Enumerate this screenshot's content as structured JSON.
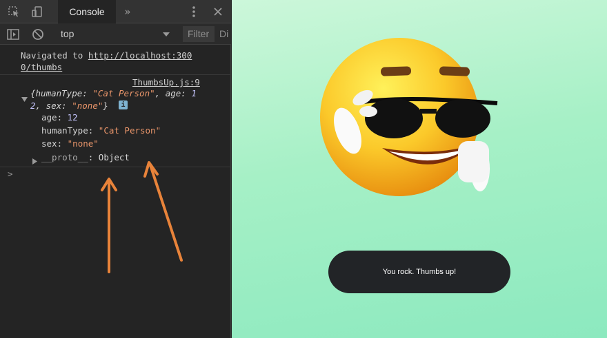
{
  "devtools": {
    "tabs": {
      "console_label": "Console"
    },
    "toolbar": {
      "context": "top",
      "filter_placeholder": "Filter",
      "overflow_text": "Di"
    },
    "console": {
      "nav_prefix": "Navigated to ",
      "nav_url_line1": "http://localhost:300",
      "nav_url_line2": "0/thumbs",
      "source_link": "ThumbsUp.js:9",
      "obj_summary": {
        "open": "{",
        "k1": "humanType",
        "v1": "\"Cat Person\"",
        "k2": "age",
        "v2_line1": "1",
        "v2_line2": "2",
        "k3": "sex",
        "v3": "\"none\"",
        "close": "}"
      },
      "props": [
        {
          "name": "age",
          "value": "12"
        },
        {
          "name": "humanType",
          "value": "\"Cat Person\""
        },
        {
          "name": "sex",
          "value": "\"none\""
        }
      ],
      "proto": {
        "name": "__proto__",
        "value": "Object"
      },
      "prompt": ">"
    },
    "icons": [
      "inspect-icon",
      "device-toggle-icon",
      "more-tabs-icon",
      "kebab-menu-icon",
      "close-icon",
      "sidebar-toggle-icon",
      "clear-console-icon",
      "dropdown-arrow-icon",
      "expand-triangle-icon",
      "info-badge-icon"
    ],
    "annotation_color": "#e8833a"
  },
  "app": {
    "button_label": "You rock. Thumbs up!",
    "background_colors": [
      "#ccf7da",
      "#8ce9bf"
    ],
    "emoji": "sunglasses-thumbs-up-emoji"
  }
}
